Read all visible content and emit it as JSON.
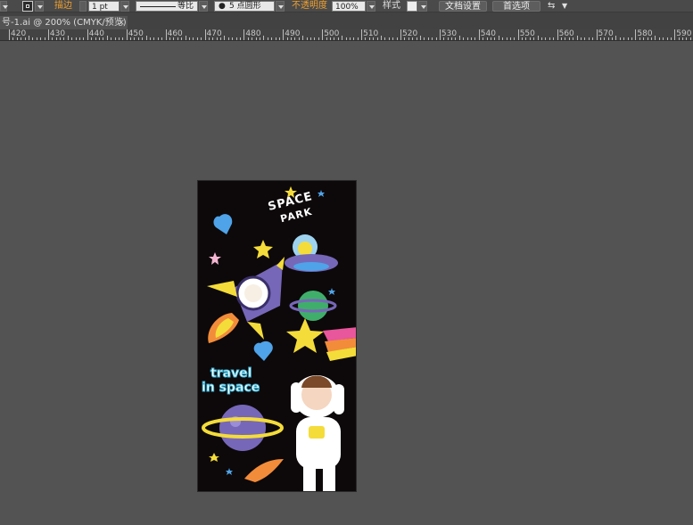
{
  "control_bar": {
    "stroke_label": "描边",
    "stroke_weight": "1 pt",
    "stroke_ratio": "等比",
    "brush_label": "5 点圆形",
    "opacity_label": "不透明度",
    "opacity_value": "100%",
    "style_label": "样式",
    "doc_setup_button": "文档设置",
    "preferences_button": "首选项"
  },
  "tab": {
    "title": "号-1.ai @ 200% (CMYK/预览)",
    "close": "×"
  },
  "ruler": {
    "labels": [
      "420",
      "430",
      "440",
      "450",
      "460",
      "470",
      "480",
      "490",
      "500",
      "510",
      "520",
      "530",
      "540",
      "550",
      "560",
      "570",
      "580",
      "590"
    ]
  },
  "artboard": {
    "space_text": "SPACE",
    "park_text": "PARK",
    "travel_text": "travel",
    "in_space_text": "in space"
  },
  "colors": {
    "artboard_bg": "#0d090a",
    "rocket_yellow": "#f4dc3a",
    "planet_purple": "#7767b8",
    "heart_blue": "#4fa3e8",
    "rainbow_pink": "#e8569c"
  }
}
